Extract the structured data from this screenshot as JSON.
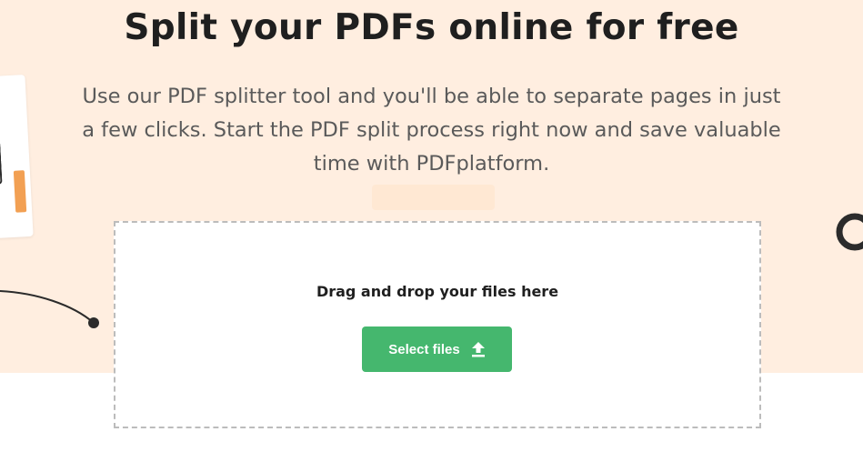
{
  "hero": {
    "title": "Split your PDFs online for free",
    "subtitle": "Use our PDF splitter tool and you'll be able to separate pages in just a few clicks. Start the PDF split process right now and save valuable time with PDFplatform.",
    "background_color": "#ffeee0"
  },
  "upload": {
    "drop_label": "Drag and drop your files here",
    "button_label": "Select files",
    "button_icon": "upload-arrow-icon",
    "button_color": "#45b76e"
  },
  "decorations": {
    "document_icon": "document-illustration",
    "accent_color": "#f2a053"
  }
}
